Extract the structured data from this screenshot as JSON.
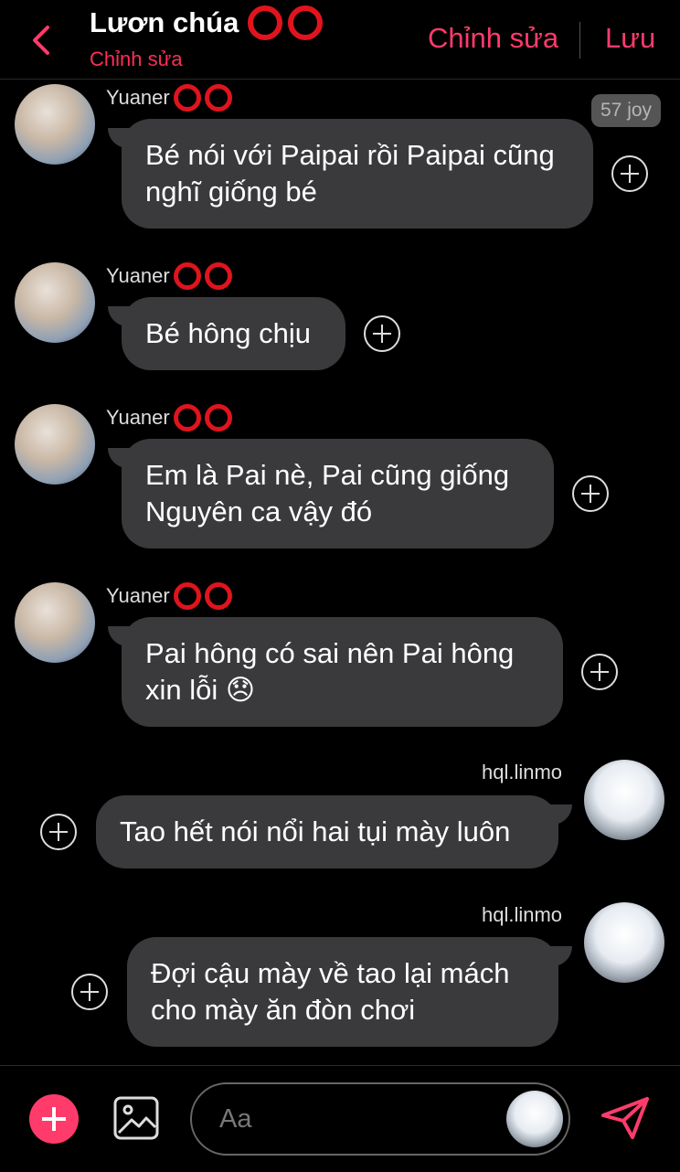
{
  "header": {
    "title": "Lươn chúa",
    "subtitle": "Chỉnh sửa",
    "edit_label": "Chỉnh sửa",
    "save_label": "Lưu"
  },
  "joy_badge": "57 joy",
  "messages": [
    {
      "sender": "Yuaner",
      "text_lines": [
        "Bé nói với Paipai rồi Paipai cũng",
        "nghĩ giống bé"
      ]
    },
    {
      "sender": "Yuaner",
      "text_lines": [
        "Bé hông chịu"
      ]
    },
    {
      "sender": "Yuaner",
      "text_lines": [
        "Em là Pai nè, Pai cũng giống",
        "Nguyên ca vậy đó"
      ]
    },
    {
      "sender": "Yuaner",
      "text_lines": [
        "Pai hông có sai nên Pai hông",
        "xin lỗi 😞"
      ]
    },
    {
      "sender": "hql.linmo",
      "text_lines": [
        "Tao hết nói nổi hai tụi mày luôn"
      ]
    },
    {
      "sender": "hql.linmo",
      "text_lines": [
        "Đợi cậu mày về tao lại mách",
        "cho mày ăn đòn chơi"
      ]
    }
  ],
  "composer": {
    "placeholder": "Aa"
  },
  "colors": {
    "accent": "#ff3b6b",
    "ring": "#e0141c",
    "bubble": "#3a3a3c"
  }
}
